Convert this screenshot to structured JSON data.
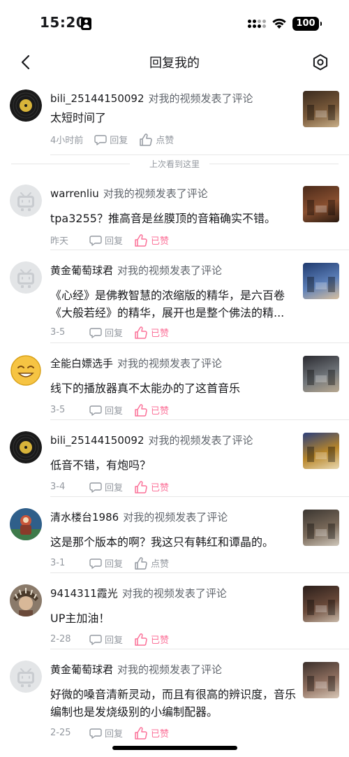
{
  "status_bar": {
    "time": "15:20",
    "battery": "100"
  },
  "header": {
    "title": "回复我的"
  },
  "divider": {
    "label": "上次看到这里"
  },
  "labels": {
    "reply": "回复",
    "like": "点赞",
    "liked": "已赞"
  },
  "comments": [
    {
      "username": "bili_25144150092",
      "action": "对我的视频发表了评论",
      "text": "太短时间了",
      "time": "4小时前",
      "liked": false,
      "avatar_icon": "vinyl-record-avatar"
    },
    {
      "username": "warrenliu",
      "action": "对我的视频发表了评论",
      "text": "tpa3255？推高音是丝膜顶的音箱确实不错。",
      "time": "昨天",
      "liked": true,
      "avatar_icon": "default-tv-avatar"
    },
    {
      "username": "黄金葡萄球君",
      "action": "对我的视频发表了评论",
      "text": "《心经》是佛教智慧的浓缩版的精华，是六百卷《大般若经》的精华，展开也是整个佛法的精...",
      "time": "3-5",
      "liked": true,
      "avatar_icon": "default-tv-avatar"
    },
    {
      "username": "全能白嫖选手",
      "action": "对我的视频发表了评论",
      "text": "线下的播放器真不太能办的了这首音乐",
      "time": "3-5",
      "liked": true,
      "avatar_icon": "smiley-avatar"
    },
    {
      "username": "bili_25144150092",
      "action": "对我的视频发表了评论",
      "text": "低音不错，有炮吗？",
      "time": "3-4",
      "liked": true,
      "avatar_icon": "vinyl-record-avatar"
    },
    {
      "username": "清水楼台1986",
      "action": "对我的视频发表了评论",
      "text": "这是那个版本的啊？我这只有韩红和谭晶的。",
      "time": "3-1",
      "liked": false,
      "avatar_icon": "character-avatar"
    },
    {
      "username": "9414311霞光",
      "action": "对我的视频发表了评论",
      "text": "UP主加油！",
      "time": "2-28",
      "liked": true,
      "avatar_icon": "headdress-avatar"
    },
    {
      "username": "黄金葡萄球君",
      "action": "对我的视频发表了评论",
      "text": "好微的嗓音清新灵动，而且有很高的辨识度，音乐编制也是发烧级别的小编制配器。",
      "time": "2-25",
      "liked": true,
      "avatar_icon": "default-tv-avatar"
    }
  ],
  "colors": {
    "accent_pink": "#fb7299",
    "gray_text": "#9499a0",
    "primary_text": "#18191c"
  }
}
